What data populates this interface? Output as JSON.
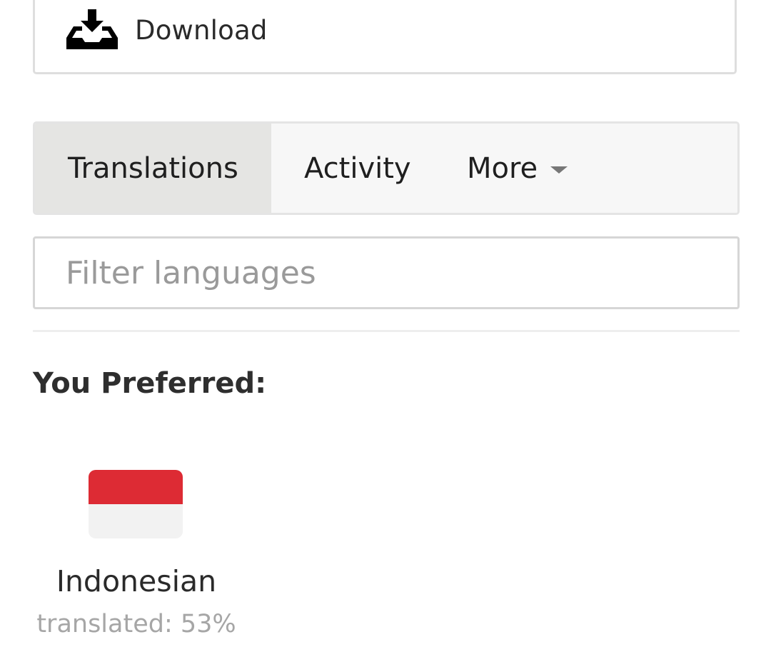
{
  "download": {
    "label": "Download",
    "icon": "download-tray-icon"
  },
  "tabs": [
    {
      "label": "Translations",
      "active": true
    },
    {
      "label": "Activity",
      "active": false
    },
    {
      "label": "More",
      "active": false,
      "dropdown": true
    }
  ],
  "filter": {
    "placeholder": "Filter languages",
    "value": ""
  },
  "preferred": {
    "heading": "You Preferred:",
    "languages": [
      {
        "name": "Indonesian",
        "progress": "translated: 53%",
        "progress_value": 53,
        "flag": {
          "top": "#dd2b34",
          "bottom": "#f2f2f2"
        }
      }
    ]
  },
  "colors": {
    "active_tab_bg": "#e5e5e3",
    "tab_bar_bg": "#f7f7f7",
    "muted_text": "#a6a6a6"
  }
}
